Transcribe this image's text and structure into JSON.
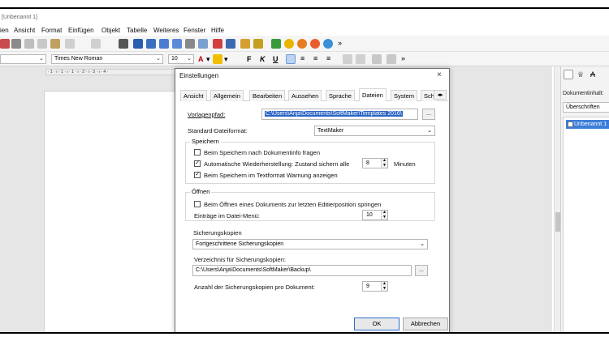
{
  "window": {
    "title": "[Unbenannt 1]"
  },
  "menu": [
    "ien",
    "Ansicht",
    "Format",
    "Einfügen",
    "Objekt",
    "Tabelle",
    "Weiteres",
    "Fenster",
    "Hilfe"
  ],
  "toolbar": {
    "font_name": "Times New Roman",
    "font_size": "10"
  },
  "ruler": {
    "text": "· 1 · ı · 1 · ı · 1 · ı · 2 · ı · 3 · ı · 4 ·"
  },
  "sidebar": {
    "label": "Dokumentinhalt:",
    "combo_value": "Überschriften",
    "tree_item": "Unbenannt 1"
  },
  "dialog": {
    "title": "Einstellungen",
    "tabs": [
      "Ansicht",
      "Allgemein",
      "Bearbeiten",
      "Aussehen",
      "Sprache",
      "Dateien",
      "System",
      "Sch"
    ],
    "active_tab": "Dateien",
    "template_path_label": "Vorlagenpfad:",
    "template_path_value": "C:\\Users\\Anja\\Documents\\SoftMaker\\Templates 2016\\",
    "browse_label": "...",
    "default_format_label": "Standard-Dateiformat:",
    "default_format_value": "TextMaker",
    "save_group": {
      "title": "Speichern",
      "opt1": "Beim Speichern nach Dokumentinfo fragen",
      "opt1_checked": false,
      "opt2": "Automatische Wiederherstellung: Zustand sichern alle",
      "opt2_checked": true,
      "opt2_value": "8",
      "opt2_unit": "Minuten",
      "opt3": "Beim Speichern im Textformat Warnung anzeigen",
      "opt3_checked": true
    },
    "open_group": {
      "title": "Öffnen",
      "opt1": "Beim Öffnen eines Dokuments zur letzten Editierposition springen",
      "opt1_checked": false,
      "recent_label": "Einträge im Datei-Menü:",
      "recent_value": "10"
    },
    "backup_group": {
      "title": "Sicherungskopien",
      "mode_value": "Fortgeschrittene Sicherungskopien",
      "folder_label": "Verzeichnis für Sicherungskopien:",
      "folder_value": "C:\\Users\\Anja\\Documents\\SoftMaker\\Backup\\",
      "count_label": "Anzahl der Sicherungskopien pro Dokument:",
      "count_value": "9"
    },
    "ok_label": "OK",
    "cancel_label": "Abbrechen"
  }
}
